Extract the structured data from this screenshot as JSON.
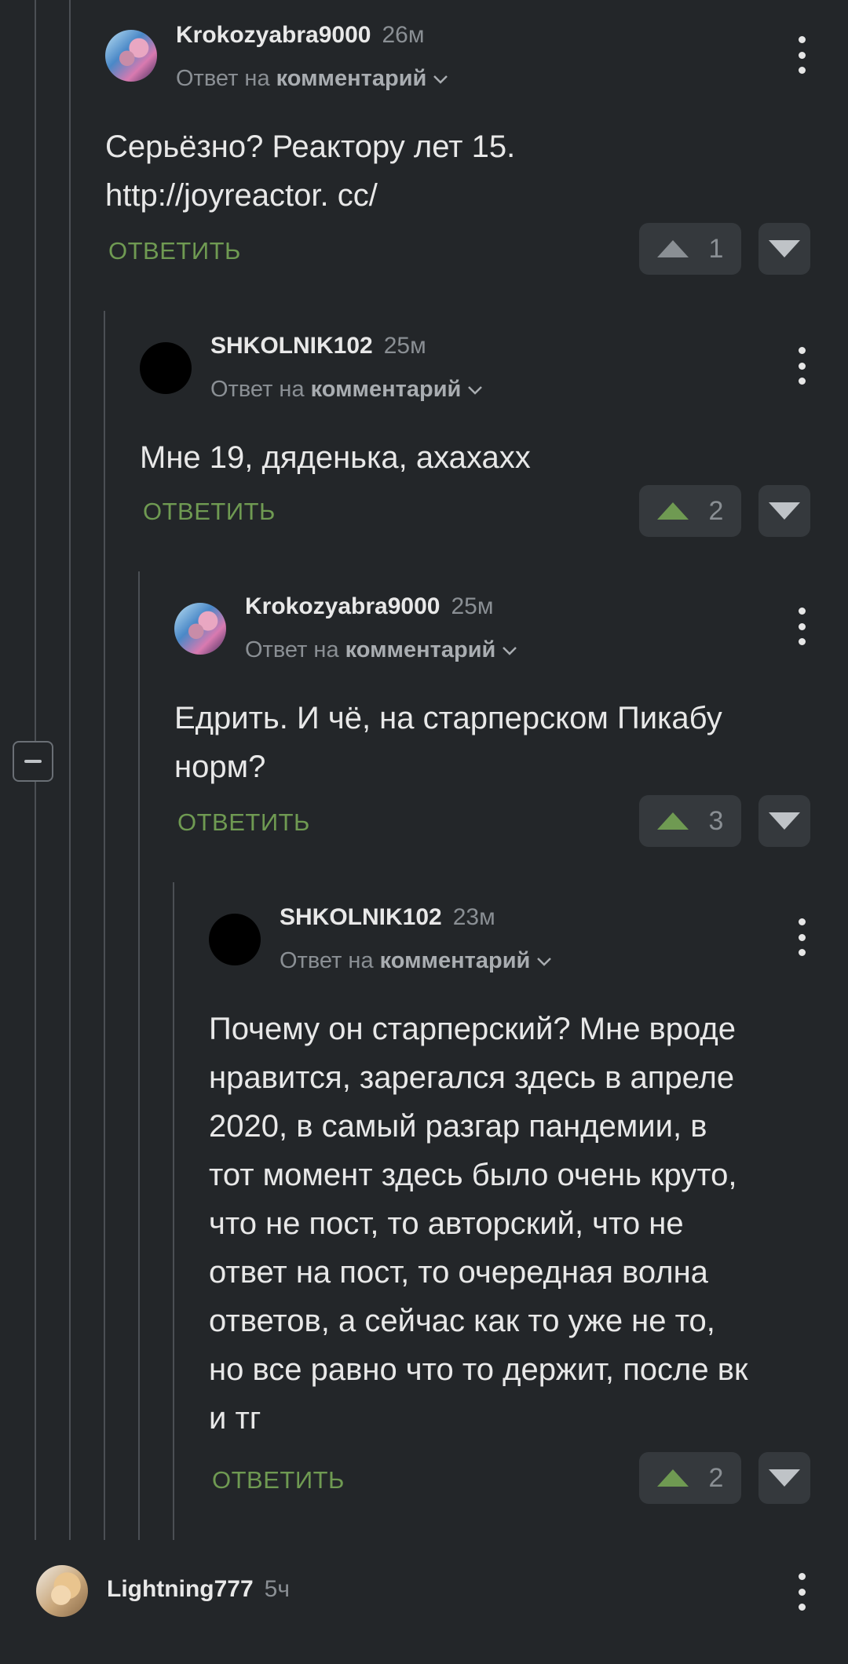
{
  "reply_label": "ОТВЕТИТЬ",
  "colors": {
    "background": "#232629",
    "accent_green": "#6f9a52",
    "muted": "#8a8f94"
  },
  "comments": [
    {
      "username": "Krokozyabra9000",
      "time": "26м",
      "reply_prefix": "Ответ на",
      "reply_target": "комментарий",
      "lines": [
        "Серьёзно? Реактору лет 15.",
        "http://joyreactor. cc/"
      ],
      "votes": "1",
      "upvoted": false
    },
    {
      "username": "SHKOLNIK102",
      "time": "25м",
      "reply_prefix": "Ответ на",
      "reply_target": "комментарий",
      "lines": [
        "Мне 19, дяденька, ахахахх"
      ],
      "votes": "2",
      "upvoted": true
    },
    {
      "username": "Krokozyabra9000",
      "time": "25м",
      "reply_prefix": "Ответ на",
      "reply_target": "комментарий",
      "lines": [
        "Едрить. И чё, на старперском Пикабу",
        "норм?"
      ],
      "votes": "3",
      "upvoted": true
    },
    {
      "username": "SHKOLNIK102",
      "time": "23м",
      "reply_prefix": "Ответ на",
      "reply_target": "комментарий",
      "lines": [
        "Почему он старперский? Мне вроде",
        "нравится, зарегался здесь в апреле",
        "2020, в самый разгар пандемии, в",
        "тот момент здесь было очень круто,",
        "что не пост, то авторский, что не",
        "ответ на пост, то очередная волна",
        "ответов, а сейчас как то уже не то,",
        "но все равно что то держит, после вк",
        "и тг"
      ],
      "votes": "2",
      "upvoted": true
    }
  ],
  "bottom_comment": {
    "username": "Lightning777",
    "time": "5ч"
  }
}
